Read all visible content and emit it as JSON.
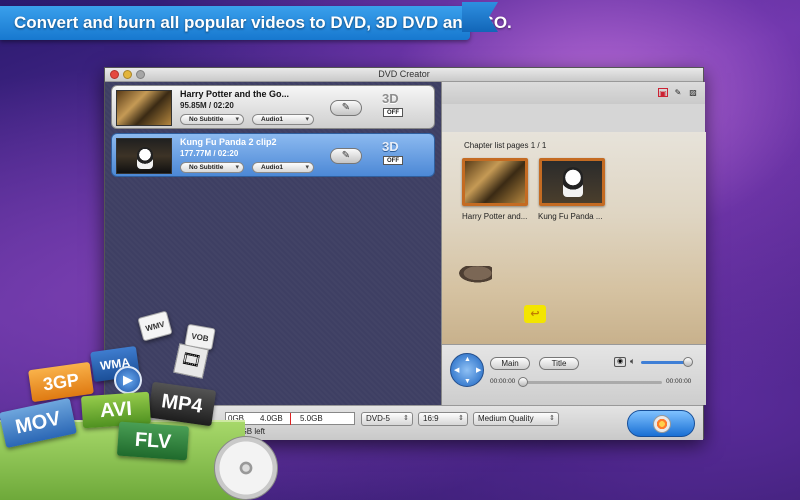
{
  "banner": {
    "text": "Convert and burn all popular videos to DVD, 3D DVD and ISO."
  },
  "window": {
    "title": "DVD Creator"
  },
  "videos": [
    {
      "title": "Harry Potter and the Go...",
      "meta": "95.85M / 02:20",
      "subtitle": "No Subtitle",
      "audio": "Audio1",
      "three_d": "3D",
      "three_d_state": "OFF"
    },
    {
      "title": "Kung Fu Panda 2 clip2",
      "meta": "177.77M / 02:20",
      "subtitle": "No Subtitle",
      "audio": "Audio1",
      "three_d": "3D",
      "three_d_state": "OFF"
    }
  ],
  "preview": {
    "chapter_label": "Chapter list pages 1 / 1",
    "chapters": [
      {
        "caption": "Harry Potter and..."
      },
      {
        "caption": "Kung Fu Panda ..."
      }
    ]
  },
  "controls": {
    "main_label": "Main",
    "title_label": "Title",
    "time_start": "00:00:00",
    "time_end": "00:00:00",
    "volume_level": 0.9,
    "seek_position": 0.0
  },
  "bottom": {
    "size_ticks": [
      "0GB",
      "4.0GB",
      "5.0GB"
    ],
    "space_left": "4.58GB left",
    "disc_type": "DVD-5",
    "aspect_ratio": "16:9",
    "quality": "Medium Quality"
  },
  "formats": [
    "MOV",
    "3GP",
    "AVI",
    "MP4",
    "FLV",
    "WMA",
    "WMV",
    "VOB"
  ]
}
